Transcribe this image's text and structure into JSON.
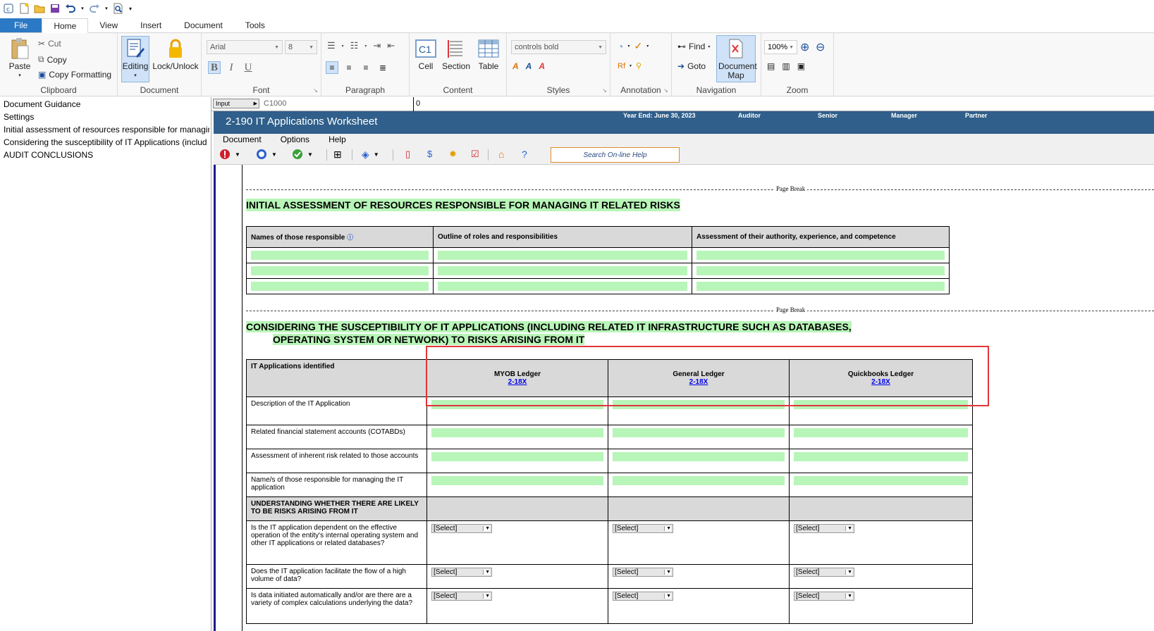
{
  "ribbon_tabs": [
    "File",
    "Home",
    "View",
    "Insert",
    "Document",
    "Tools"
  ],
  "clipboard": {
    "paste": "Paste",
    "cut": "Cut",
    "copy": "Copy",
    "copy_formatting": "Copy Formatting",
    "title": "Clipboard"
  },
  "document_group": {
    "editing": "Editing",
    "lock": "Lock/Unlock",
    "title": "Document"
  },
  "font_group": {
    "font": "Arial",
    "size": "8",
    "bold": "B",
    "italic": "I",
    "underline": "U",
    "title": "Font"
  },
  "paragraph_group": {
    "title": "Paragraph"
  },
  "content_group": {
    "cell": "Cell",
    "cell_icon_text": "C1",
    "section": "Section",
    "table": "Table",
    "title": "Content"
  },
  "styles_group": {
    "style": "controls bold",
    "title": "Styles"
  },
  "annotation_group": {
    "title": "Annotation"
  },
  "navigation_group": {
    "find": "Find",
    "goto": "Goto",
    "document_map": "Document Map",
    "title": "Navigation"
  },
  "zoom_group": {
    "zoom": "100%",
    "title": "Zoom"
  },
  "left_nav": [
    "Document Guidance",
    "Settings",
    "Initial assessment of resources responsible for managin",
    "Considering the susceptibility of IT Applications (includ",
    "AUDIT CONCLUSIONS"
  ],
  "formula_bar": {
    "mode": "Input",
    "cell": "C1000",
    "value": "0"
  },
  "header": {
    "title": "2-190 IT Applications Worksheet",
    "year_end": "Year End: June 30, 2023",
    "auditor": "Auditor",
    "senior": "Senior",
    "manager": "Manager",
    "partner": "Partner"
  },
  "doc_menu": [
    "Document",
    "Options",
    "Help"
  ],
  "search_help": "Search On-line Help",
  "page_break_label": "Page Break",
  "section1": {
    "title": "INITIAL ASSESSMENT OF RESOURCES RESPONSIBLE FOR MANAGING IT RELATED RISKS",
    "columns": [
      "Names of those responsible",
      "Outline of roles and responsibilities",
      "Assessment of their authority, experience, and competence"
    ]
  },
  "section2": {
    "title_line1": "CONSIDERING THE SUSCEPTIBILITY OF IT APPLICATIONS (INCLUDING RELATED IT INFRASTRUCTURE SUCH AS DATABASES,",
    "title_line2": "OPERATING SYSTEM OR NETWORK) TO RISKS ARISING FROM IT",
    "corner": "IT Applications identified",
    "apps": [
      {
        "name": "MYOB Ledger",
        "ref": "2-18X"
      },
      {
        "name": "General Ledger",
        "ref": "2-18X"
      },
      {
        "name": "Quickbooks Ledger",
        "ref": "2-18X"
      }
    ],
    "rows": [
      "Description of the IT Application",
      "Related financial statement accounts (COTABDs)",
      "Assessment of inherent risk related to those accounts",
      "Name/s of those responsible for managing the IT application"
    ],
    "subheader": "UNDERSTANDING WHETHER THERE ARE LIKELY TO BE RISKS ARISING FROM IT",
    "questions": [
      "Is the IT application dependent on the effective operation of the entity's internal operating system and other IT applications or related databases?",
      "Does the IT application facilitate the flow of a high volume of data?",
      "Is data initiated automatically and/or are there are a variety of complex calculations underlying the data?"
    ],
    "select_label": "[Select]"
  }
}
